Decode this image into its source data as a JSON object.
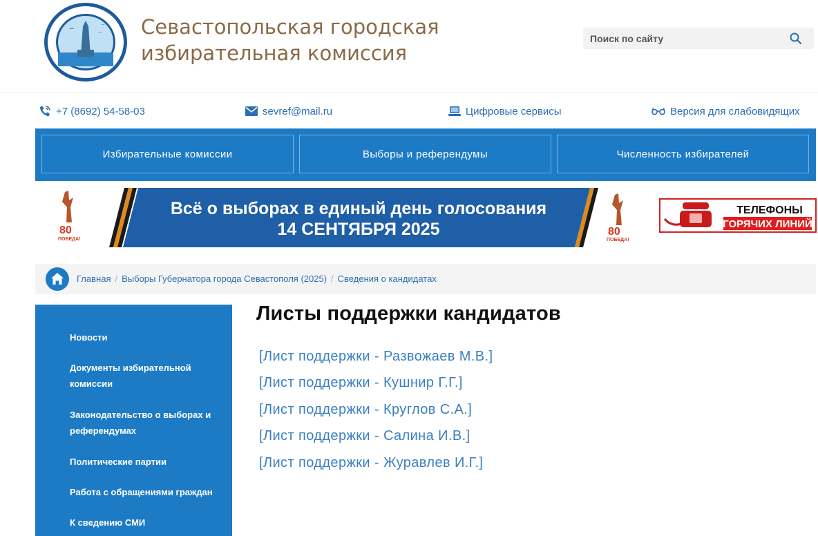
{
  "header": {
    "title": "Севастопольская городская избирательная комиссия",
    "search_placeholder": "Поиск по сайту"
  },
  "contacts": {
    "phone": "+7 (8692) 54-58-03",
    "email": "sevref@mail.ru",
    "digital": "Цифровые сервисы",
    "accessible": "Версия для слабовидящих"
  },
  "nav": {
    "items": [
      {
        "label": "Избирательные комиссии"
      },
      {
        "label": "Выборы и референдумы"
      },
      {
        "label": "Численность избирателей"
      }
    ]
  },
  "banner": {
    "line1": "Всё о выборах в единый день голосования",
    "line2": "14 СЕНТЯБРЯ 2025",
    "badge": "80",
    "badge_caption": "ПОБЕДА!",
    "hotline_1": "ТЕЛЕФОНЫ",
    "hotline_2": "ГОРЯЧИХ ЛИНИЙ"
  },
  "breadcrumb": {
    "items": [
      {
        "label": "Главная"
      },
      {
        "label": "Выборы Губернатора города Севастополя (2025)"
      },
      {
        "label": "Сведения о кандидатах"
      }
    ]
  },
  "sidebar": {
    "items": [
      {
        "label": "Новости"
      },
      {
        "label": "Документы избирательной комиссии"
      },
      {
        "label": "Законодательство о выборах и референдумах"
      },
      {
        "label": "Политические партии"
      },
      {
        "label": "Работа с обращениями граждан"
      },
      {
        "label": "К сведению СМИ"
      }
    ]
  },
  "content": {
    "title": "Листы поддержки кандидатов",
    "links": [
      {
        "label": "[Лист поддержки - Развожаев М.В.]"
      },
      {
        "label": "[Лист поддержки - Кушнир Г.Г.]"
      },
      {
        "label": "[Лист поддержки - Круглов С.А.]"
      },
      {
        "label": "[Лист поддержки - Салина И.В.]"
      },
      {
        "label": "[Лист поддержки - Журавлев И.Г.]"
      }
    ]
  },
  "colors": {
    "brand_blue": "#1d7bc6",
    "title_brown": "#8a6a45",
    "link_blue": "#3a7fc0",
    "hotline_red": "#e21d1d"
  }
}
